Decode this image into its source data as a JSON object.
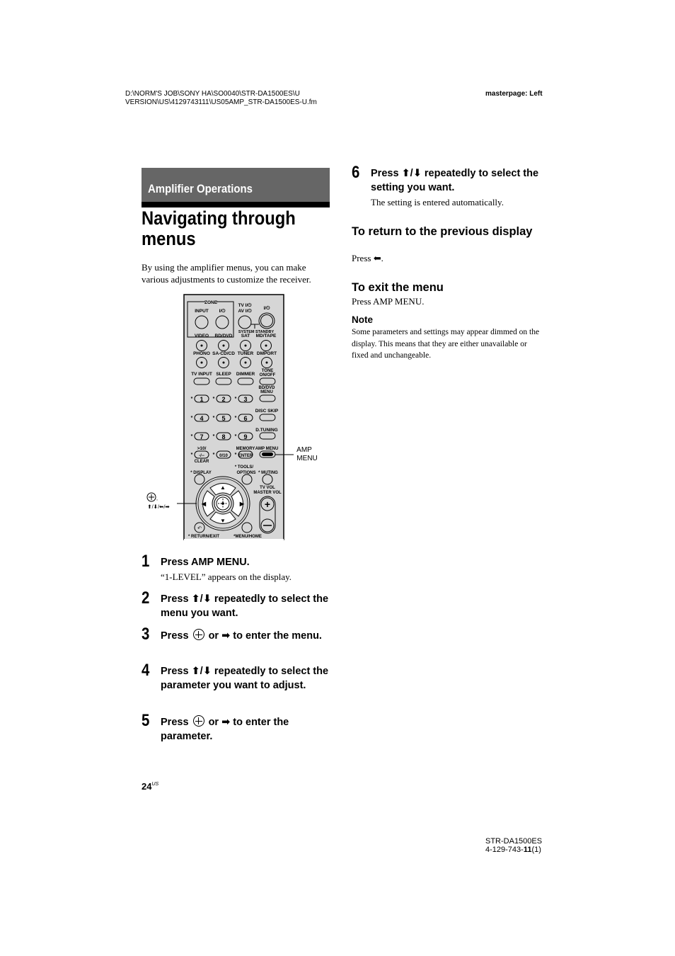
{
  "header": {
    "file_path_line1": "D:\\NORM'S JOB\\SONY HA\\SO0040\\STR-DA1500ES\\U",
    "file_path_line2": "VERSION\\US\\4129743111\\US05AMP_STR-DA1500ES-U.fm",
    "masterpage": "masterpage: Left"
  },
  "section": "Amplifier Operations",
  "title": "Navigating through menus",
  "intro": "By using the amplifier menus, you can make various adjustments to customize the receiver.",
  "remote": {
    "zone_label": "ZONE",
    "buttons": {
      "input": "INPUT",
      "zone_power": "I/⏻",
      "tv_power": "TV I/⏻",
      "av_power": "AV I/⏻",
      "power": "I/⏻",
      "system_standby": "SYSTEM STANDBY",
      "video": "VIDEO",
      "bd_dvd": "BD/DVD",
      "sat": "SAT",
      "md_tape": "MD/TAPE",
      "phono": "PHONO",
      "sa_cd": "SA-CD/CD",
      "tuner": "TUNER",
      "dmport": "DMPORT",
      "tv_input": "TV INPUT",
      "sleep": "SLEEP",
      "dimmer": "DIMMER",
      "tone": "TONE ON/OFF",
      "bd_dvd_menu": "BD/DVD MENU",
      "disc_skip": "DISC SKIP",
      "d_tuning": "D.TUNING",
      "n1": "1",
      "n2": "2",
      "n3": "3",
      "n4": "4",
      "n5": "5",
      "n6": "6",
      "n7": "7",
      "n8": "8",
      "n9": "9",
      "gt10": ">10/",
      "dash": "-/--",
      "clear": "CLEAR",
      "n0": "0/10",
      "memory": "MEMORY",
      "enter": "ENTER",
      "amp_menu": "AMP MENU",
      "display": "* DISPLAY",
      "tools": "* TOOLS/",
      "options": "OPTIONS",
      "muting": "* MUTING",
      "tv_vol": "TV VOL",
      "master_vol": "MASTER VOL",
      "return": "* RETURN/EXIT",
      "menu_home": "*MENU/HOME"
    },
    "callouts": {
      "amp_menu_1": "AMP",
      "amp_menu_2": "MENU",
      "nav": "⬆/⬇/⬅/➡"
    }
  },
  "steps": [
    {
      "num": "1",
      "title": "Press AMP MENU.",
      "sub": "“1-LEVEL” appears on the display."
    },
    {
      "num": "2",
      "title": "Press ⬆/⬇ repeatedly to select the menu you want."
    },
    {
      "num": "3",
      "title_pre": "Press",
      "title_post": "or ➡ to enter the menu."
    },
    {
      "num": "4",
      "title": "Press ⬆/⬇ repeatedly to select the parameter you want to adjust."
    },
    {
      "num": "5",
      "title_pre": "Press",
      "title_post": "or ➡ to enter the parameter."
    },
    {
      "num": "6",
      "title": "Press ⬆/⬇ repeatedly to select the setting you want.",
      "sub": "The setting is entered automatically."
    }
  ],
  "return_section": {
    "heading": "To return to the previous display",
    "body": "Press ⬅."
  },
  "exit_section": {
    "heading": "To exit the menu",
    "body": "Press AMP MENU."
  },
  "note": {
    "heading": "Note",
    "body": "Some parameters and settings may appear dimmed on the display. This means that they are either unavailable or fixed and unchangeable."
  },
  "footer": {
    "page": "24",
    "page_suffix": "US",
    "model": "STR-DA1500ES",
    "code_pre": "4-129-743-",
    "code_bold": "11",
    "code_post": "(1)"
  }
}
